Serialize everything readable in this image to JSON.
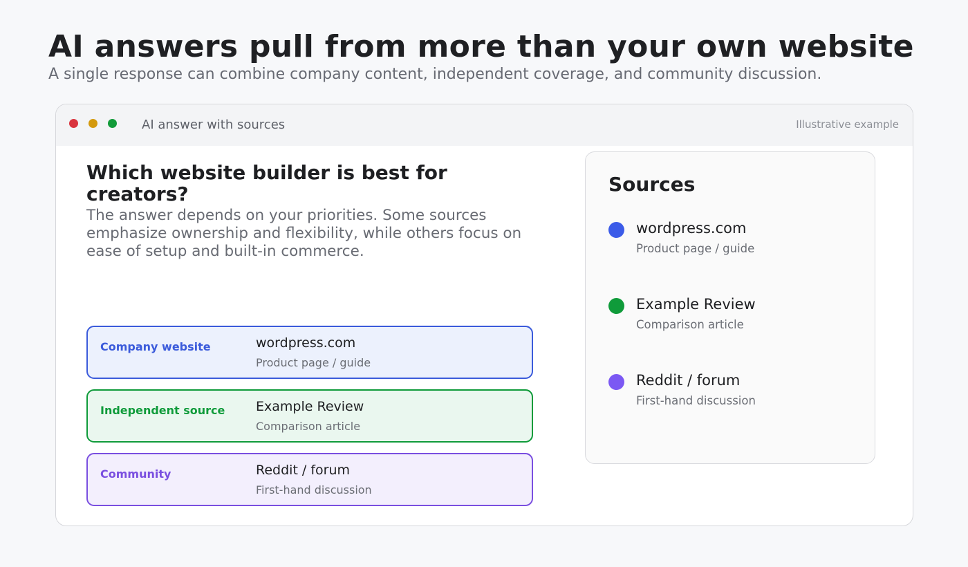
{
  "header": {
    "title": "AI answers pull from more than your own website",
    "subtitle": "A single response can combine company content, independent coverage, and community discussion."
  },
  "window": {
    "title": "AI answer with sources",
    "note": "Illustrative example",
    "dots": {
      "red": "#d9343e",
      "yellow": "#d49a0e",
      "green": "#129b3a"
    }
  },
  "answer": {
    "question": "Which website builder is best for creators?",
    "body": "The answer depends on your priorities. Some sources emphasize ownership and flexibility, while others focus on ease of setup and built-in commerce."
  },
  "source_cards": [
    {
      "category": "Company website",
      "name": "wordpress.com",
      "description": "Product page / guide",
      "color": "#3b5bdb",
      "fill": "#ecf1fd"
    },
    {
      "category": "Independent source",
      "name": "Example Review",
      "description": "Comparison article",
      "color": "#0f9b3a",
      "fill": "#eaf7ef"
    },
    {
      "category": "Community",
      "name": "Reddit / forum",
      "description": "First-hand discussion",
      "color": "#7a4fe0",
      "fill": "#f3effd"
    }
  ],
  "sources_panel": {
    "title": "Sources",
    "items": [
      {
        "name": "wordpress.com",
        "description": "Product page / guide",
        "color": "#3b5be8"
      },
      {
        "name": "Example Review",
        "description": "Comparison article",
        "color": "#0f9b3a"
      },
      {
        "name": "Reddit / forum",
        "description": "First-hand discussion",
        "color": "#7b58f3"
      }
    ]
  }
}
